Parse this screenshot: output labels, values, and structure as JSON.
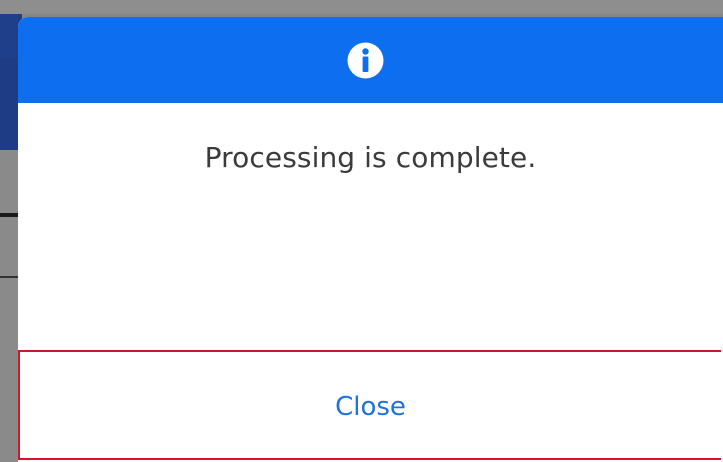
{
  "dialog": {
    "header": {
      "icon": "info-icon",
      "color": "#0e6ef0"
    },
    "message": "Processing is complete.",
    "close_button": {
      "label": "Close",
      "focus_outline_color": "#d4142c"
    }
  }
}
